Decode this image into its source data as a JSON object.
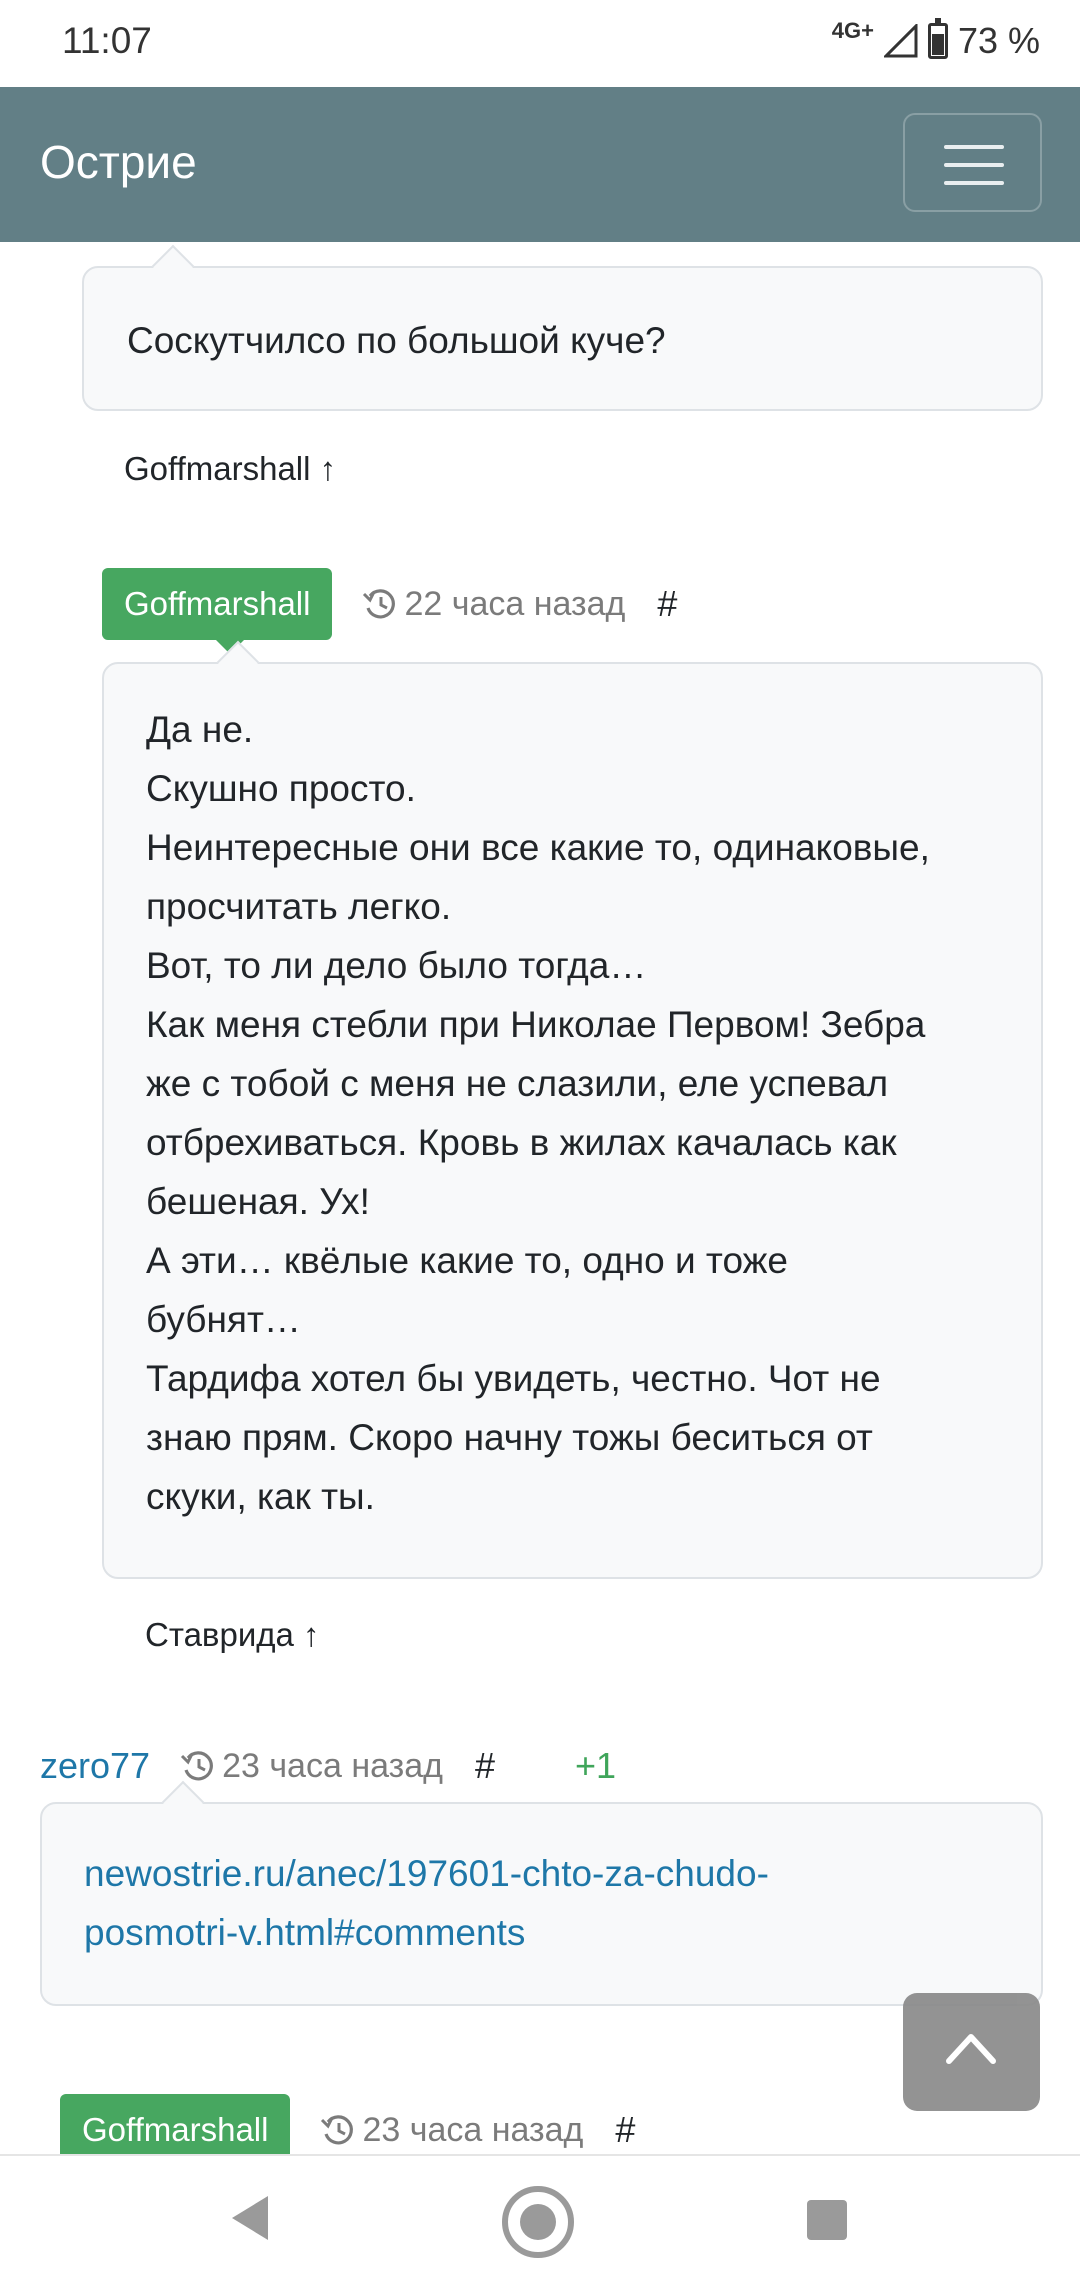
{
  "status_bar": {
    "time": "11:07",
    "network": "4G+",
    "battery": "73 %",
    "battery_level": 0.73
  },
  "header": {
    "brand": "Острие",
    "menu_icon": "hamburger-menu-icon"
  },
  "comments": [
    {
      "text_lines": [
        "Соскутчилсо по большой куче?"
      ],
      "reply_to": "Goffmarshall ↑"
    },
    {
      "author": "Goffmarshall",
      "author_style": "badge",
      "time": "22 часа назад",
      "anchor": "#",
      "text_lines": [
        "Да не.",
        "Скушно просто.",
        "Неинтересные они все какие то, одинаковые,",
        "просчитать легко.",
        "Вот, то ли дело было тогда…",
        "Как меня стебли при Николае Первом! Зебра",
        "же с тобой с меня не слазили, еле успевал",
        "отбрехиваться. Кровь в жилах качалась как",
        "бешеная. Ух!",
        "А эти… квёлые какие то, одно и тоже",
        "бубнят…",
        "Тардифа хотел бы увидеть, честно. Чот не",
        "знаю прям. Скоро начну тожы беситься от",
        "скуки, как ты."
      ],
      "reply_to": "Ставрида ↑"
    },
    {
      "author": "zero77",
      "author_style": "link",
      "time": "23 часа назад",
      "anchor": "#",
      "rating": "+1",
      "text_lines": [
        "newostrie.ru/anec/197601-chto-za-chudo-",
        "posmotri-v.html#comments"
      ]
    },
    {
      "author": "Goffmarshall",
      "author_style": "badge",
      "time": "23 часа назад",
      "anchor": "#"
    }
  ],
  "colors": {
    "navbar": "#627f86",
    "badge": "#47a760",
    "link": "#1e77a8",
    "rating": "#3fa55a"
  }
}
